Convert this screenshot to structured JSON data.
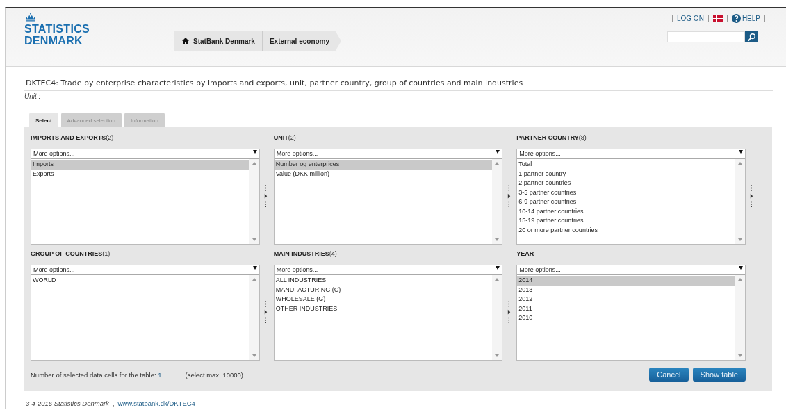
{
  "header": {
    "logo_line_1": "STATISTICS",
    "logo_line_2": "DENMARK",
    "breadcrumbs": [
      {
        "label": "StatBank Denmark",
        "kind": "home"
      },
      {
        "label": "External economy",
        "kind": "plain"
      }
    ],
    "top_links": [
      {
        "label": "LOG ON",
        "kind": "text"
      },
      {
        "kind": "flag"
      },
      {
        "label": "HELP",
        "kind": "help"
      }
    ]
  },
  "page": {
    "title": "DKTEC4: Trade by enterprise characteristics by imports and exports, unit, partner country, group of countries and main industries",
    "unit": "Unit : -"
  },
  "tabs": [
    {
      "label": "Select",
      "selected": true
    },
    {
      "label": "Advanced selection",
      "selected": false
    },
    {
      "label": "Information",
      "selected": false
    }
  ],
  "panels": [
    {
      "title": "IMPORTS AND EXPORTS",
      "count": "(2)",
      "dropdown": "More options...",
      "has_handle": true,
      "items": [
        {
          "label": "Imports",
          "selected": true
        },
        {
          "label": "Exports",
          "selected": false
        }
      ]
    },
    {
      "title": "UNIT",
      "count": "(2)",
      "dropdown": "More options...",
      "has_handle": true,
      "items": [
        {
          "label": "Number og enterprices",
          "selected": true
        },
        {
          "label": "Value (DKK million)",
          "selected": false
        }
      ]
    },
    {
      "title": "PARTNER COUNTRY",
      "count": "(8)",
      "dropdown": "More options...",
      "has_handle": true,
      "items": [
        {
          "label": "Total",
          "selected": false
        },
        {
          "label": "1 partner country",
          "selected": false
        },
        {
          "label": "2 partner countries",
          "selected": false
        },
        {
          "label": "3-5 partner countries",
          "selected": false
        },
        {
          "label": "6-9 partner countries",
          "selected": false
        },
        {
          "label": "10-14 partner countries",
          "selected": false
        },
        {
          "label": "15-19 partner countries",
          "selected": false
        },
        {
          "label": "20 or more partner countries",
          "selected": false
        }
      ]
    },
    {
      "title": "GROUP OF COUNTRIES",
      "count": "(1)",
      "dropdown": "More options...",
      "has_handle": true,
      "items": [
        {
          "label": "WORLD",
          "selected": false
        }
      ]
    },
    {
      "title": "MAIN INDUSTRIES",
      "count": "(4)",
      "dropdown": "More options...",
      "has_handle": true,
      "items": [
        {
          "label": "ALL INDUSTRIES",
          "selected": false
        },
        {
          "label": "MANUFACTURING (C)",
          "selected": false
        },
        {
          "label": "WHOLESALE (G)",
          "selected": false
        },
        {
          "label": "OTHER INDUSTRIES",
          "selected": false
        }
      ]
    },
    {
      "title": "YEAR",
      "dropdown": "More options...",
      "has_handle": false,
      "items": [
        {
          "label": "2014",
          "selected": true
        },
        {
          "label": "2013",
          "selected": false
        },
        {
          "label": "2012",
          "selected": false
        },
        {
          "label": "2011",
          "selected": false
        },
        {
          "label": "2010",
          "selected": false
        }
      ]
    }
  ],
  "summary": {
    "label": "Number of selected data cells for the table:",
    "value": "1",
    "max": "(select max. 10000)"
  },
  "buttons": [
    "Cancel",
    "Show table"
  ],
  "footer": {
    "date": "3-4-2016 Statistics Denmark",
    "separator": ",",
    "link": "www.statbank.dk/DKTEC4"
  }
}
